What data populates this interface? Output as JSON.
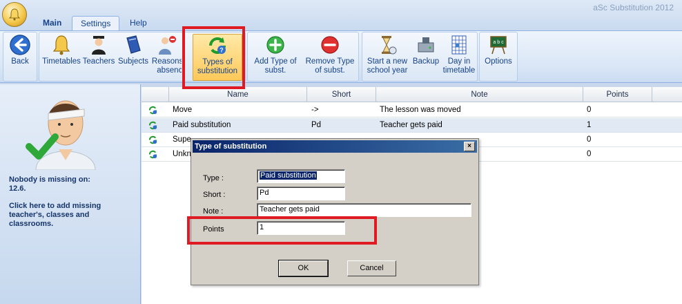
{
  "app": {
    "title": "aSc Substitution 2012"
  },
  "tabs": [
    {
      "label": "Main"
    },
    {
      "label": "Settings"
    },
    {
      "label": "Help"
    }
  ],
  "ribbon": {
    "back": "Back",
    "timetables": "Timetables",
    "teachers": "Teachers",
    "subjects": "Subjects",
    "reasons": "Reasons of absence",
    "types": "Types of substitution",
    "add_type": "Add Type of subst.",
    "remove_type": "Remove Type of subst.",
    "new_year": "Start a new school year",
    "backup": "Backup",
    "day": "Day in timetable",
    "options": "Options"
  },
  "left_panel": {
    "missing_title": "Nobody is missing on:",
    "missing_date": "12.6.",
    "add_hint": "Click here to add missing teacher's, classes and classrooms."
  },
  "grid": {
    "columns": [
      "Name",
      "Short",
      "Note",
      "Points"
    ],
    "rows": [
      {
        "name": "Move",
        "short": "->",
        "note": "The lesson was moved",
        "points": "0"
      },
      {
        "name": "Paid substitution",
        "short": "Pd",
        "note": "Teacher gets paid",
        "points": "1"
      },
      {
        "name": "Supe",
        "short": "",
        "note": "",
        "points": "0"
      },
      {
        "name": "Unkn",
        "short": "",
        "note": "",
        "points": "0"
      }
    ]
  },
  "dialog": {
    "title": "Type of substitution",
    "close_glyph": "×",
    "type_label": "Type :",
    "type_value": "Paid substitution",
    "short_label": "Short :",
    "short_value": "Pd",
    "note_label": "Note :",
    "note_value": "Teacher gets paid",
    "points_label": "Points",
    "points_value": "1",
    "ok_label": "OK",
    "cancel_label": "Cancel"
  },
  "colors": {
    "highlight": "#e01a22",
    "ribbon_active": "#ffc95a",
    "dialog_title": "#0a246a"
  }
}
